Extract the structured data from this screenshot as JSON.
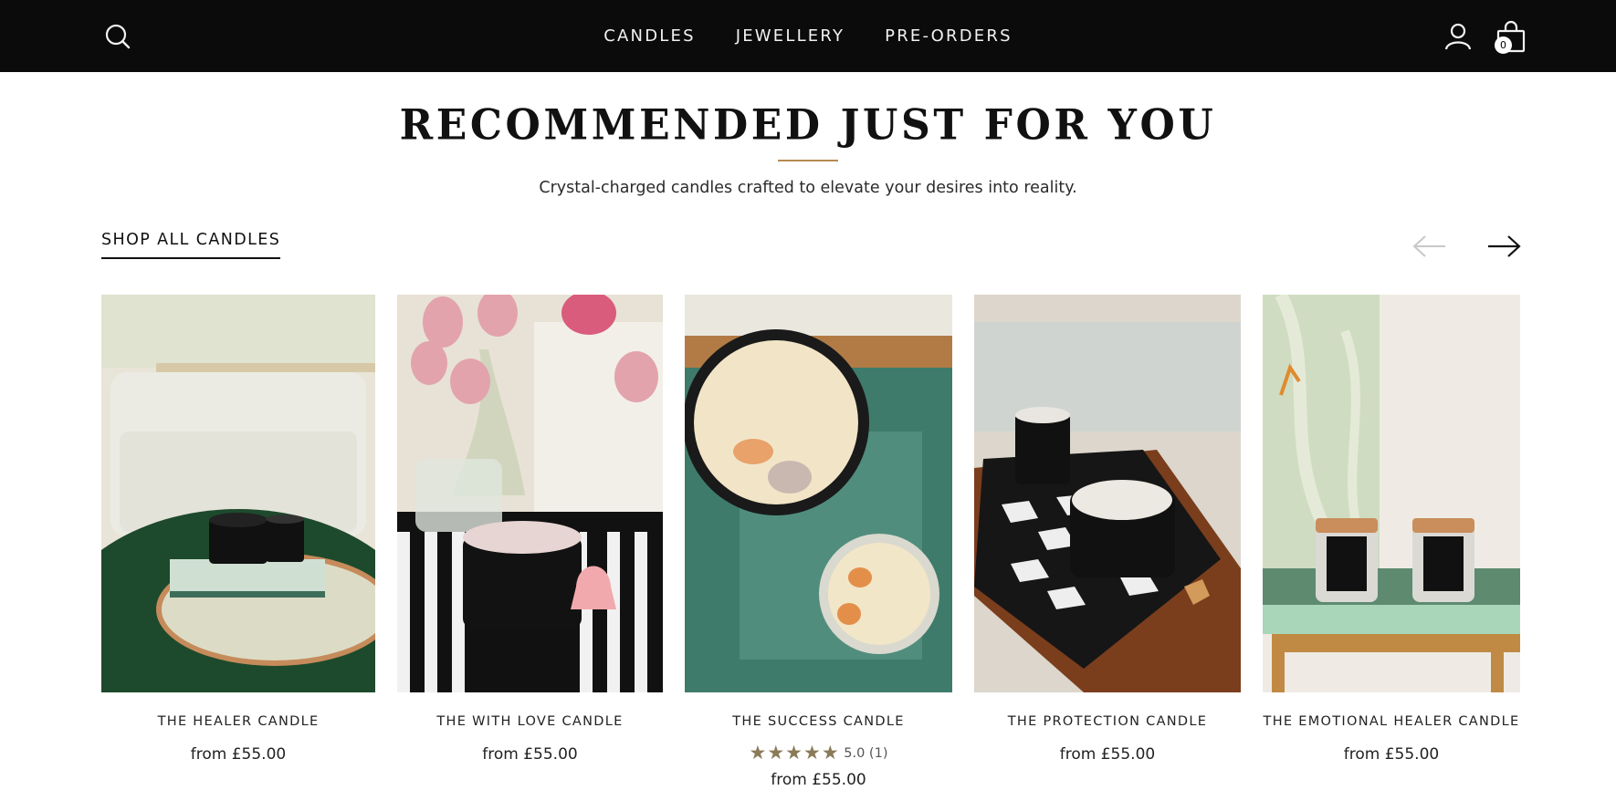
{
  "header": {
    "nav": [
      {
        "label": "CANDLES"
      },
      {
        "label": "JEWELLERY"
      },
      {
        "label": "PRE-ORDERS"
      }
    ],
    "cart_count": "0",
    "icons": {
      "search": "search-icon",
      "account": "user-icon",
      "cart": "shopping-bag-icon"
    }
  },
  "section": {
    "title": "RECOMMENDED JUST FOR YOU",
    "subtitle": "Crystal-charged candles crafted to elevate your desires into reality.",
    "shop_all_label": "SHOP ALL CANDLES",
    "accent_color": "#b58a52"
  },
  "products": [
    {
      "name": "THE HEALER CANDLE",
      "price": "from £55.00"
    },
    {
      "name": "THE WITH LOVE CANDLE",
      "price": "from £55.00"
    },
    {
      "name": "THE SUCCESS CANDLE",
      "price": "from £55.00",
      "rating_stars": "★★★★★",
      "rating_text": "5.0 (1)"
    },
    {
      "name": "THE PROTECTION CANDLE",
      "price": "from £55.00"
    },
    {
      "name": "THE EMOTIONAL HEALER CANDLE",
      "price": "from £55.00"
    }
  ]
}
